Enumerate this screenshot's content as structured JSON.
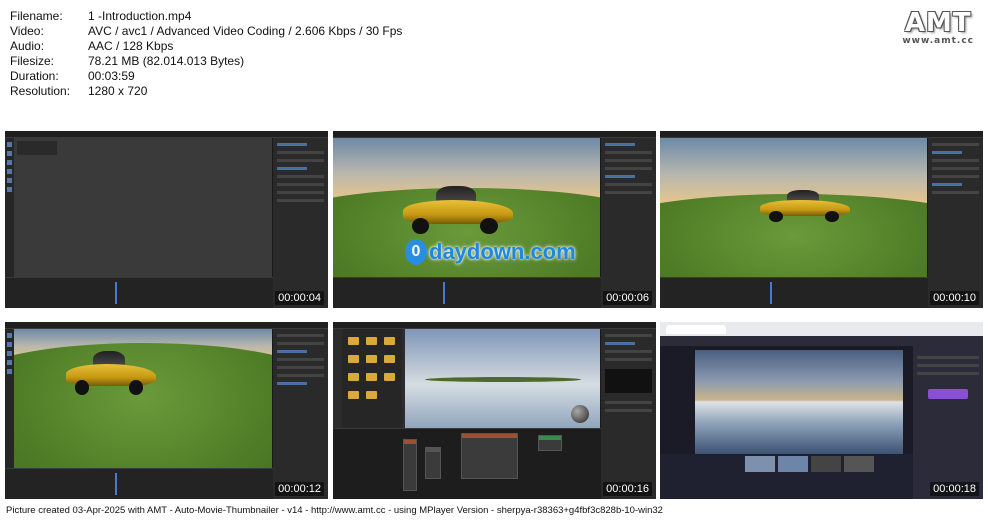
{
  "info": {
    "filename_label": "Filename:",
    "filename": "1 -Introduction.mp4",
    "video_label": "Video:",
    "video": "AVC / avc1 / Advanced Video Coding / 2.606 Kbps / 30 Fps",
    "audio_label": "Audio:",
    "audio": "AAC / 128 Kbps",
    "filesize_label": "Filesize:",
    "filesize": "78.21 MB (82.014.013 Bytes)",
    "duration_label": "Duration:",
    "duration": "00:03:59",
    "resolution_label": "Resolution:",
    "resolution": "1280 x 720"
  },
  "logo": {
    "title": "AMT",
    "url": "www.amt.cc"
  },
  "thumbnails": [
    {
      "timestamp": "00:00:04",
      "scene": "empty-viewport"
    },
    {
      "timestamp": "00:00:06",
      "scene": "car-watermark"
    },
    {
      "timestamp": "00:00:10",
      "scene": "car-far"
    },
    {
      "timestamp": "00:00:12",
      "scene": "car-close"
    },
    {
      "timestamp": "00:00:16",
      "scene": "node-editor"
    },
    {
      "timestamp": "00:00:18",
      "scene": "poly-haven"
    }
  ],
  "watermark": {
    "icon_letter": "0",
    "text": "daydown.com"
  },
  "footer": {
    "text": "Picture created 03-Apr-2025 with AMT - Auto-Movie-Thumbnailer - v14 - http://www.amt.cc - using MPlayer Version - sherpya-r38363+g4fbf3c828b-10-win32"
  }
}
